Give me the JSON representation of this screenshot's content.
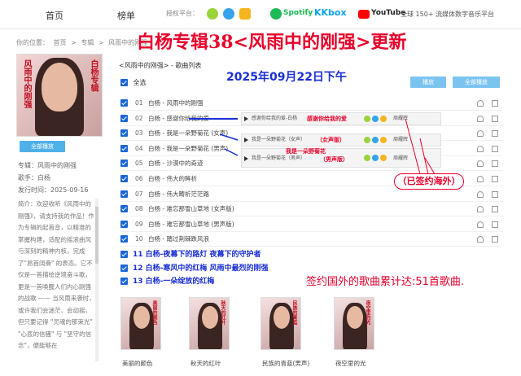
{
  "nav": {
    "home": "首页",
    "charts": "榜单",
    "partners_label": "授权平台：",
    "spotify": "Spotify",
    "kkbox": "KKbox",
    "youtube": "YouTube",
    "global": "全球 150+ 流媒体数字音乐平台"
  },
  "breadcrumb": [
    "你的位置：",
    "首页",
    ">",
    "专辑",
    ">",
    "风雨中的刚强"
  ],
  "headline": "白杨专辑38<风雨中的刚强>更新",
  "dateline": "2025年09月22日下午",
  "cover": {
    "text_right": "白杨专辑",
    "text_left": "风雨中的刚强"
  },
  "left": {
    "play_all": "全部播放",
    "album_label": "专辑：风雨中的刚强",
    "singer_label": "歌手：白杨",
    "date_label": "发行时间：2025-09-16",
    "intro": "简介：欢迎收听《风雨中的刚强》，请支持我的作品！作为专辑的起首音，以精准的掌握构建，适配的摇滚曲风与深刻的精神内核，完成了\"昂首阔斋\" 的表态。它不仅是一首描绘逆境奋斗歌，更是一首唤醒人们内心刚强的战歌 —— 当风雨来袭时，或许我们会迷茫、会动摇，但只要记得 \"灵魂的那束光\" \"心底的信骚\" 与 \"坚守的信念\"，便能够在"
  },
  "list": {
    "title": "<风雨中的刚强> - 歌曲列表",
    "select_all": "全选",
    "play": "播放",
    "play_all": "全部播放"
  },
  "songs": [
    {
      "num": "01",
      "title": "白杨 - 风雨中的刚强"
    },
    {
      "num": "02",
      "title": "白杨 - 感谢你给我的爱"
    },
    {
      "num": "03",
      "title": "白杨 - 我是一朵野菊花 (女声)"
    },
    {
      "num": "04",
      "title": "白杨 - 我是一朵野菊花 (男声)"
    },
    {
      "num": "05",
      "title": "白杨 - 沙漠中的奇迹"
    },
    {
      "num": "06",
      "title": "白杨 - 伟大的眸析"
    },
    {
      "num": "07",
      "title": "白杨 - 伟大畴析茫茫路"
    },
    {
      "num": "08",
      "title": "白杨 - 难忘那雪山草地 (女声版)"
    },
    {
      "num": "09",
      "title": "白杨 - 难忘那雪山草地 (男声版)"
    },
    {
      "num": "10",
      "title": "白杨 - 踏过荆棘跌风浪"
    }
  ],
  "bold_songs": [
    "11 白杨-夜幕下的路灯   夜幕下的守护者",
    "12 白杨-寒风中的红梅   风雨中最烈的刚强",
    "13 白杨-一朵绽放的红梅"
  ],
  "players": [
    {
      "title": "感谢你给我的爱-白杨",
      "annotation": "感谢你给我的爱",
      "artist": "周耀辉"
    },
    {
      "title": "我是一朵野菊花（女声）",
      "annotation": "（女声版）",
      "artist": "周耀辉"
    },
    {
      "title": "我是一朵野菊花（男声）",
      "annotation": "我是一朵野菊花",
      "annotation2": "（男声版）",
      "artist": "周耀辉"
    }
  ],
  "signed_badge": "（已签约海外）",
  "total": "签约国外的歌曲累计达:51首歌曲.",
  "albums": [
    {
      "cover_text": "美丽的颜色",
      "caption": "美丽的颜色"
    },
    {
      "cover_text": "秋天的红叶",
      "caption": "秋天的红叶"
    },
    {
      "cover_text": "民族的青蓝",
      "caption": "民族的青蓝(男声)"
    },
    {
      "cover_text": "夜空里的光",
      "caption": "夜空里的光"
    }
  ],
  "colors": {
    "headline": "#e8002a",
    "dateline": "#1a2fd6",
    "accent": "#4fb0e8"
  }
}
